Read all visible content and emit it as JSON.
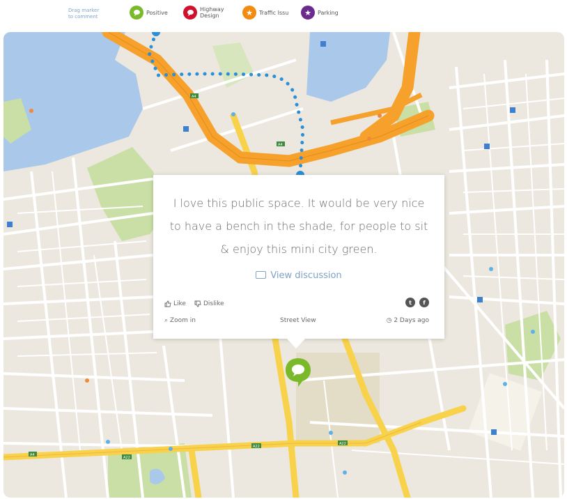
{
  "legend": {
    "hint": "Drag marker\nto comment",
    "items": [
      {
        "label": "Positive",
        "color": "#7ab929",
        "icon": "speech-bubble-icon"
      },
      {
        "label": "Highway\nDesign",
        "color": "#d0102c",
        "icon": "speech-bubble-icon"
      },
      {
        "label": "Traffic Issu",
        "color": "#f28c10",
        "icon": "star-icon"
      },
      {
        "label": "Parking",
        "color": "#6a2a8e",
        "icon": "star-icon"
      }
    ]
  },
  "popup": {
    "comment": "I love this public space. It would be very nice to have a bench in the shade, for people to sit & enjoy this mini city green.",
    "view_discussion": "View discussion",
    "like": "Like",
    "dislike": "Dislike",
    "zoom_in": "Zoom in",
    "street_view": "Street View",
    "time_ago": "2 Days ago"
  },
  "map": {
    "road_labels": [
      "A4",
      "A4",
      "A22",
      "A22",
      "A4",
      "A22"
    ],
    "colors": {
      "water": "#aac8ea",
      "highway": "#f5a12c",
      "main_road": "#f7d24a",
      "park": "#c9dfa6",
      "route": "#2a8fd6"
    }
  }
}
